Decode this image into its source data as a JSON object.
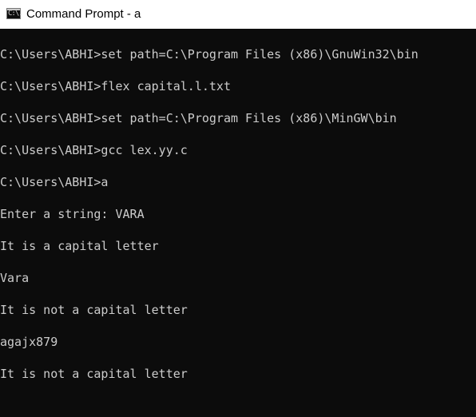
{
  "window": {
    "title": "Command Prompt - a",
    "icon": "cmd-icon",
    "icon_glyph": "C:\\."
  },
  "console": {
    "lines": [
      "C:\\Users\\ABHI>set path=C:\\Program Files (x86)\\GnuWin32\\bin",
      "C:\\Users\\ABHI>flex capital.l.txt",
      "C:\\Users\\ABHI>set path=C:\\Program Files (x86)\\MinGW\\bin",
      "C:\\Users\\ABHI>gcc lex.yy.c",
      "C:\\Users\\ABHI>a",
      "Enter a string: VARA",
      "It is a capital letter",
      "Vara",
      "It is not a capital letter",
      "agajx879",
      "It is not a capital letter"
    ]
  },
  "colors": {
    "background": "#0c0c0c",
    "text": "#cccccc",
    "titlebar": "#ffffff"
  }
}
